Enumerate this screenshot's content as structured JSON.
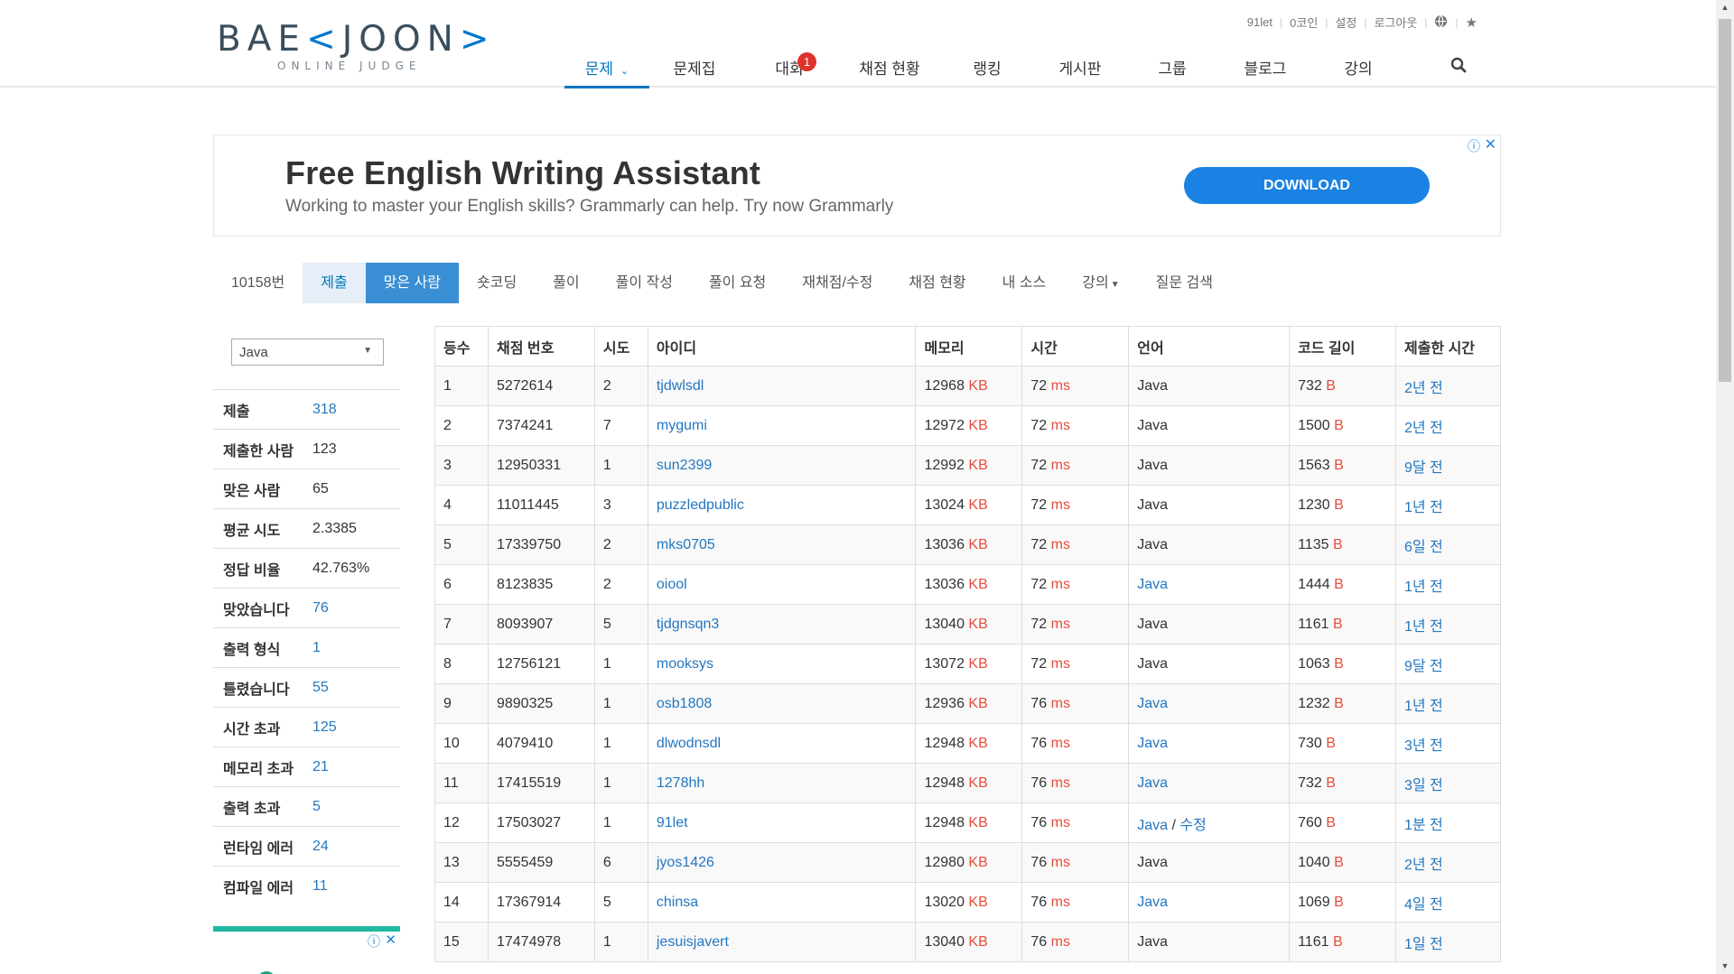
{
  "header": {
    "logo_main_left": "BAE",
    "logo_main_accent": "<",
    "logo_main_right": "JOON",
    "logo_main_end": ">",
    "logo_sub": "ONLINE JUDGE",
    "topbar": [
      "91let",
      "0코인",
      "설정",
      "로그아웃"
    ],
    "nav": [
      {
        "label": "문제",
        "active": true
      },
      {
        "label": "문제집"
      },
      {
        "label": "대회",
        "badge": "1"
      },
      {
        "label": "채점 현황"
      },
      {
        "label": "랭킹"
      },
      {
        "label": "게시판"
      },
      {
        "label": "그룹"
      },
      {
        "label": "블로그"
      },
      {
        "label": "강의"
      }
    ]
  },
  "ad": {
    "title": "Free English Writing Assistant",
    "subtitle": "Working to master your English skills? Grammarly can help. Try now Grammarly",
    "button": "DOWNLOAD",
    "info": "ⓘ",
    "close": "✕"
  },
  "problem_menu": [
    "10158번",
    "제출",
    "맞은 사람",
    "숏코딩",
    "풀이",
    "풀이 작성",
    "풀이 요청",
    "재채점/수정",
    "채점 현황",
    "내 소스",
    "강의",
    "질문 검색"
  ],
  "language_select": "Java",
  "stats": [
    {
      "label": "제출",
      "value": "318",
      "link": true
    },
    {
      "label": "제출한 사람",
      "value": "123"
    },
    {
      "label": "맞은 사람",
      "value": "65"
    },
    {
      "label": "평균 시도",
      "value": "2.3385"
    },
    {
      "label": "정답 비율",
      "value": "42.763%"
    },
    {
      "label": "맞았습니다",
      "value": "76",
      "link": true
    },
    {
      "label": "출력 형식",
      "value": "1",
      "link": true
    },
    {
      "label": "틀렸습니다",
      "value": "55",
      "link": true
    },
    {
      "label": "시간 초과",
      "value": "125",
      "link": true
    },
    {
      "label": "메모리 초과",
      "value": "21",
      "link": true
    },
    {
      "label": "출력 초과",
      "value": "5",
      "link": true
    },
    {
      "label": "런타임 에러",
      "value": "24",
      "link": true
    },
    {
      "label": "컴파일 에러",
      "value": "11",
      "link": true
    }
  ],
  "table": {
    "headers": [
      "등수",
      "채점 번호",
      "시도",
      "아이디",
      "메모리",
      "시간",
      "언어",
      "코드 길이",
      "제출한 시간"
    ],
    "mem_unit": "KB",
    "time_unit": "ms",
    "len_unit": "B",
    "rows": [
      {
        "rank": "1",
        "sub": "5272614",
        "try": "2",
        "id": "tjdwlsdl",
        "mem": "12968",
        "time": "72",
        "lang": "Java",
        "lang_link": false,
        "len": "732",
        "when": "2년 전"
      },
      {
        "rank": "2",
        "sub": "7374241",
        "try": "7",
        "id": "mygumi",
        "mem": "12972",
        "time": "72",
        "lang": "Java",
        "lang_link": false,
        "len": "1500",
        "when": "2년 전"
      },
      {
        "rank": "3",
        "sub": "12950331",
        "try": "1",
        "id": "sun2399",
        "mem": "12992",
        "time": "72",
        "lang": "Java",
        "lang_link": false,
        "len": "1563",
        "when": "9달 전"
      },
      {
        "rank": "4",
        "sub": "11011445",
        "try": "3",
        "id": "puzzledpublic",
        "mem": "13024",
        "time": "72",
        "lang": "Java",
        "lang_link": false,
        "len": "1230",
        "when": "1년 전"
      },
      {
        "rank": "5",
        "sub": "17339750",
        "try": "2",
        "id": "mks0705",
        "mem": "13036",
        "time": "72",
        "lang": "Java",
        "lang_link": false,
        "len": "1135",
        "when": "6일 전"
      },
      {
        "rank": "6",
        "sub": "8123835",
        "try": "2",
        "id": "oiool",
        "mem": "13036",
        "time": "72",
        "lang": "Java",
        "lang_link": true,
        "len": "1444",
        "when": "1년 전"
      },
      {
        "rank": "7",
        "sub": "8093907",
        "try": "5",
        "id": "tjdgnsqn3",
        "mem": "13040",
        "time": "72",
        "lang": "Java",
        "lang_link": false,
        "len": "1161",
        "when": "1년 전"
      },
      {
        "rank": "8",
        "sub": "12756121",
        "try": "1",
        "id": "mooksys",
        "mem": "13072",
        "time": "72",
        "lang": "Java",
        "lang_link": false,
        "len": "1063",
        "when": "9달 전"
      },
      {
        "rank": "9",
        "sub": "9890325",
        "try": "1",
        "id": "osb1808",
        "mem": "12936",
        "time": "76",
        "lang": "Java",
        "lang_link": true,
        "len": "1232",
        "when": "1년 전"
      },
      {
        "rank": "10",
        "sub": "4079410",
        "try": "1",
        "id": "dlwodnsdl",
        "mem": "12948",
        "time": "76",
        "lang": "Java",
        "lang_link": true,
        "len": "730",
        "when": "3년 전"
      },
      {
        "rank": "11",
        "sub": "17415519",
        "try": "1",
        "id": "1278hh",
        "mem": "12948",
        "time": "76",
        "lang": "Java",
        "lang_link": true,
        "len": "732",
        "when": "3일 전"
      },
      {
        "rank": "12",
        "sub": "17503027",
        "try": "1",
        "id": "91let",
        "mem": "12948",
        "time": "76",
        "lang": "Java",
        "lang_link": true,
        "edit": "수정",
        "len": "760",
        "when": "1분 전"
      },
      {
        "rank": "13",
        "sub": "5555459",
        "try": "6",
        "id": "jyos1426",
        "mem": "12980",
        "time": "76",
        "lang": "Java",
        "lang_link": false,
        "len": "1040",
        "when": "2년 전"
      },
      {
        "rank": "14",
        "sub": "17367914",
        "try": "5",
        "id": "chinsa",
        "mem": "13020",
        "time": "76",
        "lang": "Java",
        "lang_link": true,
        "len": "1069",
        "when": "4일 전"
      },
      {
        "rank": "15",
        "sub": "17474978",
        "try": "1",
        "id": "jesuisjavert",
        "mem": "13040",
        "time": "76",
        "lang": "Java",
        "lang_link": false,
        "len": "1161",
        "when": "1일 전"
      }
    ]
  },
  "colors": {
    "link": "#2377c1",
    "unit": "#e74c3c",
    "accent": "#0076c0",
    "ad_button": "#1a82e2",
    "badge": "#e0322b"
  }
}
